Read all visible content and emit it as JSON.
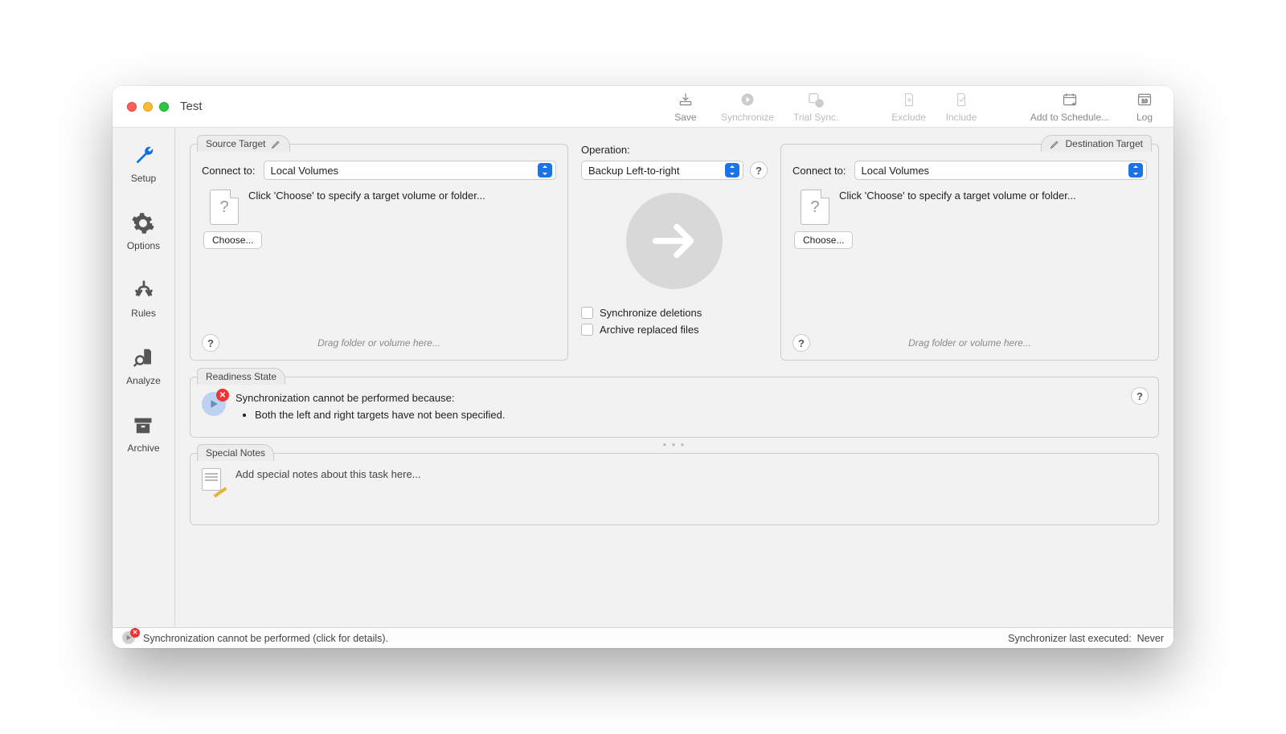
{
  "title": "Test",
  "toolbar": {
    "save": "Save",
    "synchronize": "Synchronize",
    "trial": "Trial Sync.",
    "exclude": "Exclude",
    "include": "Include",
    "schedule": "Add to Schedule...",
    "log": "Log"
  },
  "sidebar": {
    "setup": "Setup",
    "options": "Options",
    "rules": "Rules",
    "analyze": "Analyze",
    "archive": "Archive"
  },
  "source": {
    "tab": "Source Target",
    "connect_label": "Connect to:",
    "connect_value": "Local Volumes",
    "hint": "Click 'Choose' to specify a target volume or folder...",
    "choose": "Choose...",
    "drag": "Drag folder or volume here..."
  },
  "destination": {
    "tab": "Destination Target",
    "connect_label": "Connect to:",
    "connect_value": "Local Volumes",
    "hint": "Click 'Choose' to specify a target volume or folder...",
    "choose": "Choose...",
    "drag": "Drag folder or volume here..."
  },
  "operation": {
    "label": "Operation:",
    "value": "Backup Left-to-right",
    "sync_del": "Synchronize deletions",
    "archive": "Archive replaced files"
  },
  "readiness": {
    "tab": "Readiness State",
    "message": "Synchronization cannot be performed because:",
    "bullet1": "Both the left and right targets have not been specified."
  },
  "notes": {
    "tab": "Special Notes",
    "placeholder": "Add special notes about this task here..."
  },
  "status": {
    "message": "Synchronization cannot be performed (click for details).",
    "right_label": "Synchronizer last executed:",
    "right_value": "Never"
  },
  "help_glyph": "?"
}
